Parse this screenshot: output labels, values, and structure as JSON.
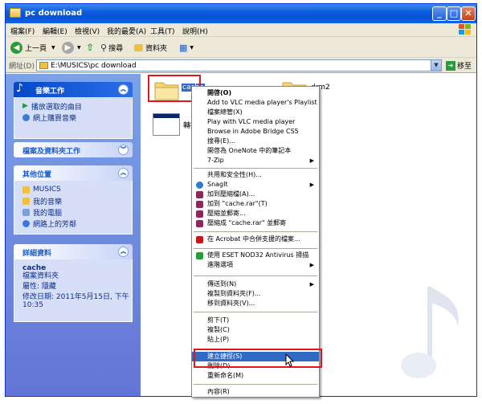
{
  "window": {
    "title": "pc download"
  },
  "menu": [
    "檔案(F)",
    "編輯(E)",
    "檢視(V)",
    "我的最愛(A)",
    "工具(T)",
    "說明(H)"
  ],
  "toolbar": {
    "back": "上一頁",
    "search": "搜尋",
    "folders": "資料夾"
  },
  "address": {
    "label": "網址(D)",
    "path": "E:\\MUSICS\\pc download",
    "go": "移至"
  },
  "sidebar": {
    "music_tasks": {
      "title": "音樂工作",
      "items": [
        "播放選取的曲目",
        "網上購買音樂"
      ]
    },
    "file_tasks": {
      "title": "檔案及資料夾工作"
    },
    "other_places": {
      "title": "其他位置",
      "items": [
        "MUSICS",
        "我的音樂",
        "我的電腦",
        "網路上的芳鄰"
      ]
    },
    "details": {
      "title": "詳細資料",
      "name": "cache",
      "type": "檔案資料夾",
      "attr": "屬性: 隱藏",
      "modified": "修改日期: 2011年5月15日, 下午 10:35"
    }
  },
  "files": {
    "cache": "cache",
    "drm2": "drm2",
    "shortcut": "轉換用"
  },
  "context_menu": {
    "items": [
      "開啓(O)",
      "Add to VLC media player's Playlist",
      "檔案總管(X)",
      "Play with VLC media player",
      "Browse in Adobe Bridge CS5",
      "搜尋(E)...",
      "開啓為 OneNote 中的筆記本",
      "7-Zip",
      "共用和安全性(H)...",
      "SnagIt",
      "加到壓縮檔(A)...",
      "加到 \"cache.rar\"(T)",
      "壓縮並郵寄...",
      "壓縮成 \"cache.rar\" 並郵寄",
      "在 Acrobat 中合併支援的檔案...",
      "使用 ESET NOD32 Antivirus 掃描",
      "進階選項",
      "傳送到(N)",
      "複製到資料夾(F)...",
      "移到資料夾(V)...",
      "剪下(T)",
      "複製(C)",
      "貼上(P)",
      "建立捷徑(S)",
      "刪除(D)",
      "重新命名(M)",
      "內容(R)"
    ]
  },
  "colors": {
    "highlight": "#316ac5",
    "annotation": "#e0151b",
    "titlebar": "#0553d6"
  }
}
